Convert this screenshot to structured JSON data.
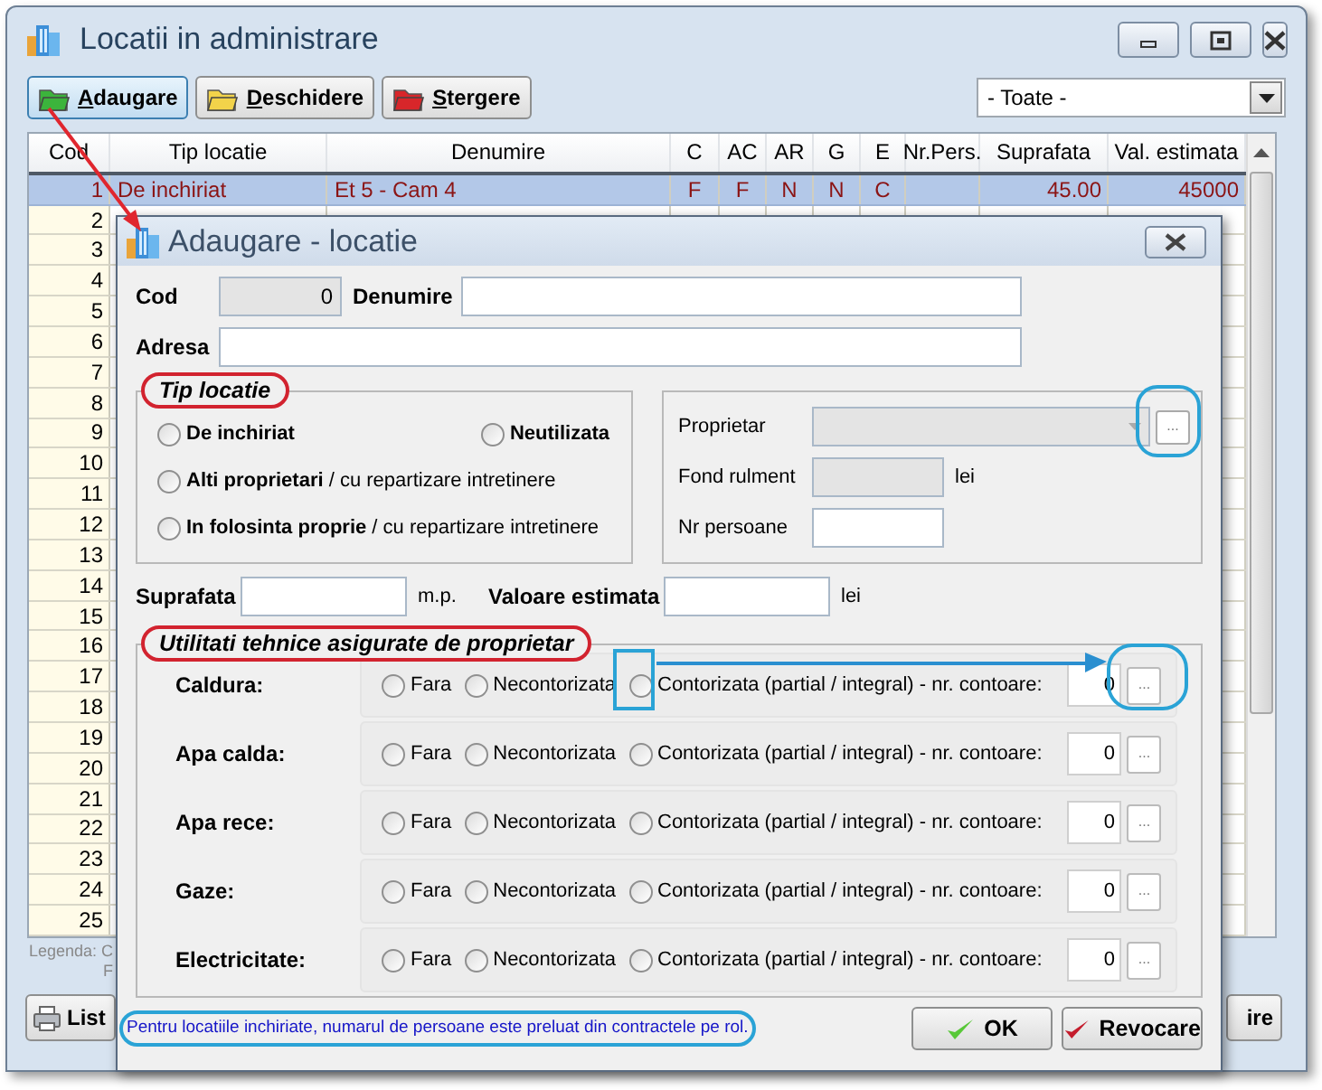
{
  "window": {
    "title": "Locatii in administrare"
  },
  "toolbar": {
    "buttons": [
      {
        "label": "Adaugare",
        "kind": "add"
      },
      {
        "label": "Deschidere",
        "kind": "open"
      },
      {
        "label": "Stergere",
        "kind": "delete"
      }
    ],
    "filter": "- Toate -"
  },
  "table": {
    "columns": [
      "Cod",
      "Tip locatie",
      "Denumire",
      "C",
      "AC",
      "AR",
      "G",
      "E",
      "Nr.Pers.",
      "Suprafata",
      "Val. estimata"
    ],
    "rows": [
      {
        "cells": [
          "1",
          "De inchiriat",
          "Et 5 - Cam 4",
          "F",
          "F",
          "N",
          "N",
          "C",
          null,
          "45.00",
          "45000"
        ],
        "selected": true
      },
      {
        "cells": [
          "2"
        ],
        "selected": false
      },
      {
        "cells": [
          "3"
        ],
        "selected": false
      },
      {
        "cells": [
          "4"
        ],
        "selected": false
      },
      {
        "cells": [
          "5"
        ],
        "selected": false
      },
      {
        "cells": [
          "6"
        ],
        "selected": false
      },
      {
        "cells": [
          "7"
        ],
        "selected": false
      },
      {
        "cells": [
          "8"
        ],
        "selected": false
      },
      {
        "cells": [
          "9"
        ],
        "selected": false
      },
      {
        "cells": [
          "10"
        ],
        "selected": false
      },
      {
        "cells": [
          "11"
        ],
        "selected": false
      },
      {
        "cells": [
          "12"
        ],
        "selected": false
      },
      {
        "cells": [
          "13"
        ],
        "selected": false
      },
      {
        "cells": [
          "14"
        ],
        "selected": false
      },
      {
        "cells": [
          "15"
        ],
        "selected": false
      },
      {
        "cells": [
          "16"
        ],
        "selected": false
      },
      {
        "cells": [
          "17"
        ],
        "selected": false
      },
      {
        "cells": [
          "18"
        ],
        "selected": false
      },
      {
        "cells": [
          "19"
        ],
        "selected": false
      },
      {
        "cells": [
          "20"
        ],
        "selected": false
      },
      {
        "cells": [
          "21"
        ],
        "selected": false
      },
      {
        "cells": [
          "22"
        ],
        "selected": false
      },
      {
        "cells": [
          "23"
        ],
        "selected": false
      },
      {
        "cells": [
          "24"
        ],
        "selected": false
      },
      {
        "cells": [
          "25"
        ],
        "selected": false
      }
    ]
  },
  "legend": [
    "Legenda: C",
    "F"
  ],
  "bottom_buttons": [
    {
      "label": "List",
      "kind": "print"
    },
    {
      "label": "ire",
      "kind": "plain"
    }
  ],
  "dialog": {
    "title": "Adaugare - locatie",
    "cod": {
      "label": "Cod",
      "value": "0"
    },
    "denumire": {
      "label": "Denumire"
    },
    "adresa": {
      "label": "Adresa"
    },
    "tip_locatie": {
      "title": "Tip locatie",
      "options": [
        {
          "label": "De inchiriat",
          "selected": false
        },
        {
          "label": "Neutilizata",
          "selected": false
        },
        {
          "label": "**Alti proprietari** / cu repartizare intretinere",
          "selected": false
        },
        {
          "label": "**In folosinta proprie** / cu repartizare intretinere",
          "selected": false
        }
      ]
    },
    "proprietar": {
      "label": "Proprietar",
      "disabled": true,
      "more": "..."
    },
    "fond_rulment": {
      "label": "Fond rulment",
      "unit": "lei",
      "disabled": true
    },
    "nr_persoane": {
      "label": "Nr persoane",
      "disabled": false
    },
    "suprafata": {
      "label": "Suprafata",
      "unit": "m.p."
    },
    "valoare_estimata": {
      "label": "Valoare estimata",
      "unit": "lei"
    },
    "utilitati": {
      "title": "Utilitati tehnice asigurate de proprietar",
      "rows": [
        {
          "label": "Caldura:",
          "options": [
            {
              "label": "Fara",
              "selected": false
            },
            {
              "label": "Necontorizata",
              "selected": false
            },
            {
              "label": "Contorizata (partial / integral) - nr. contoare:",
              "selected": false
            }
          ],
          "contoare": "0",
          "more": "..."
        },
        {
          "label": "Apa calda:",
          "options": [
            {
              "label": "Fara",
              "selected": false
            },
            {
              "label": "Necontorizata",
              "selected": false
            },
            {
              "label": "Contorizata (partial / integral) - nr. contoare:",
              "selected": false
            }
          ],
          "contoare": "0",
          "more": "..."
        },
        {
          "label": "Apa rece:",
          "options": [
            {
              "label": "Fara",
              "selected": false
            },
            {
              "label": "Necontorizata",
              "selected": false
            },
            {
              "label": "Contorizata (partial / integral) - nr. contoare:",
              "selected": false
            }
          ],
          "contoare": "0",
          "more": "..."
        },
        {
          "label": "Gaze:",
          "options": [
            {
              "label": "Fara",
              "selected": false
            },
            {
              "label": "Necontorizata",
              "selected": false
            },
            {
              "label": "Contorizata (partial / integral) - nr. contoare:",
              "selected": false
            }
          ],
          "contoare": "0",
          "more": "..."
        },
        {
          "label": "Electricitate:",
          "options": [
            {
              "label": "Fara",
              "selected": false
            },
            {
              "label": "Necontorizata",
              "selected": false
            },
            {
              "label": "Contorizata (partial / integral) - nr. contoare:",
              "selected": false
            }
          ],
          "contoare": "0",
          "more": "..."
        }
      ]
    },
    "note": "Pentru locatiile inchiriate, numarul de persoane este preluat din contractele pe rol.",
    "buttons": [
      {
        "label": "OK",
        "kind": "ok"
      },
      {
        "label": "Revocare",
        "kind": "cancel"
      }
    ]
  }
}
